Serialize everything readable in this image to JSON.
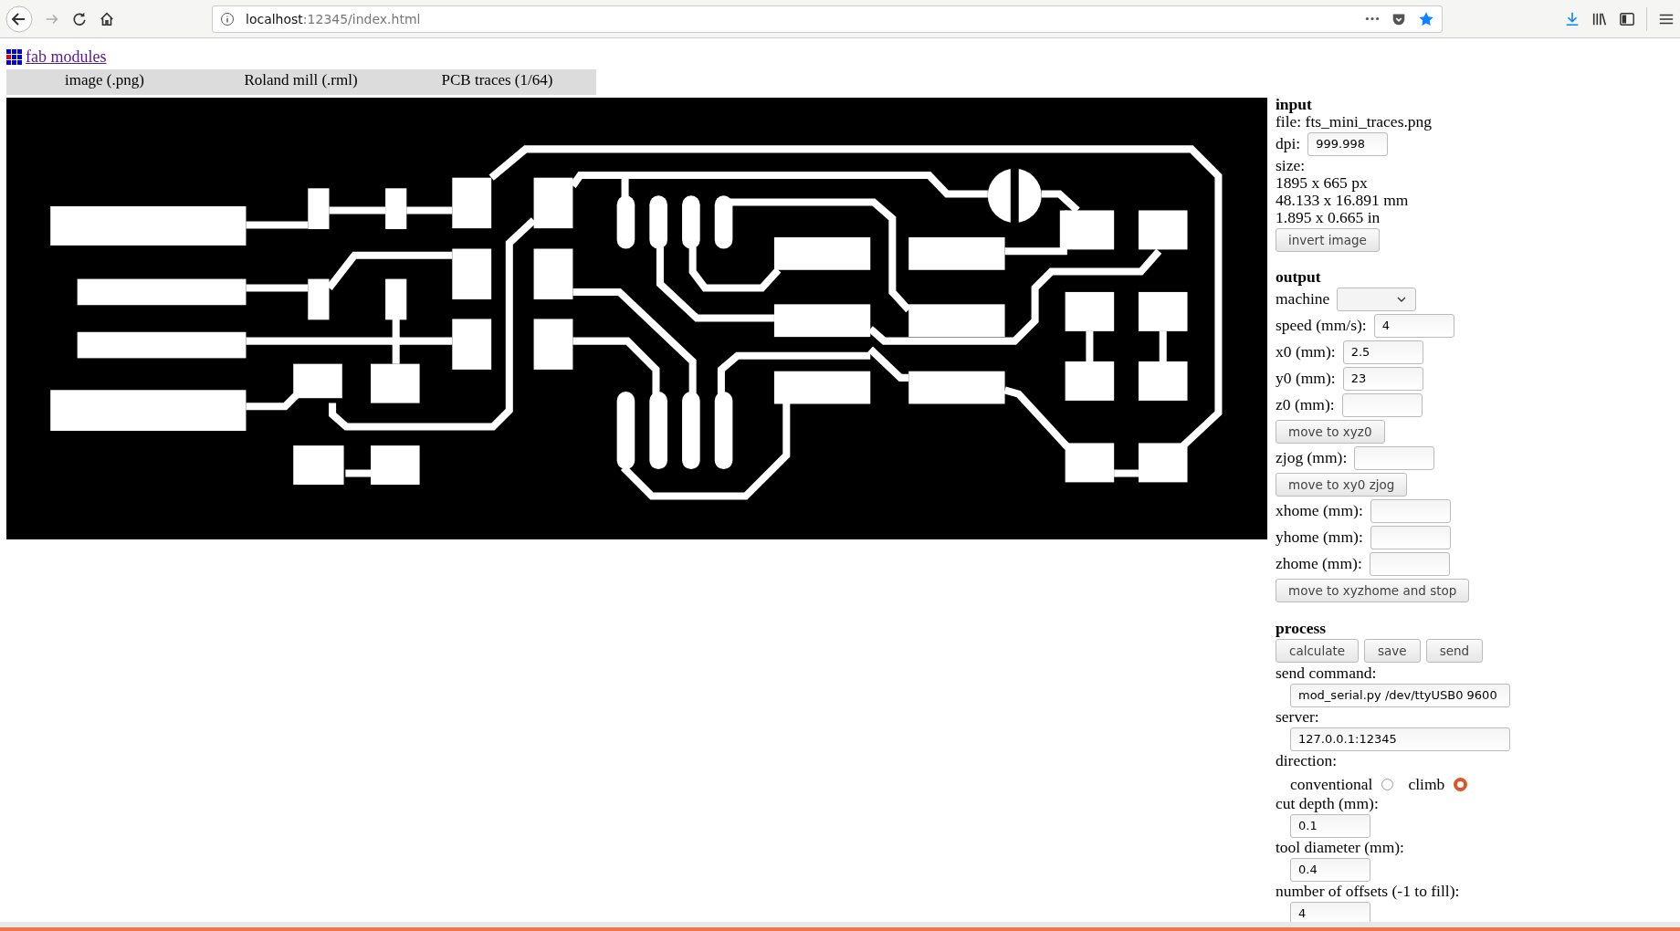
{
  "browser": {
    "url_host": "localhost",
    "url_path": ":12345/index.html"
  },
  "header": {
    "logo_link": "fab modules"
  },
  "modules": [
    "image (.png)",
    "Roland mill (.rml)",
    "PCB traces (1/64)"
  ],
  "input": {
    "heading": "input",
    "file": "file: fts_mini_traces.png",
    "dpi_label": "dpi:",
    "dpi_value": "999.998",
    "size_label": "size:",
    "size_lines": [
      "1895 x 665 px",
      "48.133 x 16.891 mm",
      "1.895 x 0.665 in"
    ],
    "button": "invert image"
  },
  "output": {
    "heading": "output",
    "controls": [
      {
        "kind": "select",
        "label": "machine"
      },
      {
        "kind": "field",
        "label": "speed (mm/s):",
        "value": "4"
      },
      {
        "kind": "field",
        "label": "x0 (mm):",
        "value": "2.5"
      },
      {
        "kind": "field",
        "label": "y0 (mm):",
        "value": "23"
      },
      {
        "kind": "field",
        "label": "z0 (mm):"
      },
      {
        "kind": "button",
        "label": "move to xyz0"
      },
      {
        "kind": "field",
        "label": "zjog (mm):"
      },
      {
        "kind": "button",
        "label": "move to xy0 zjog"
      },
      {
        "kind": "field",
        "label": "xhome (mm):"
      },
      {
        "kind": "field",
        "label": "yhome (mm):"
      },
      {
        "kind": "field",
        "label": "zhome (mm):"
      },
      {
        "kind": "button",
        "label": "move to xyzhome and stop"
      }
    ]
  },
  "process": {
    "heading": "process",
    "buttons": [
      "calculate",
      "save",
      "send"
    ],
    "items": [
      {
        "kind": "field",
        "label": "send command:",
        "value": "mod_serial.py /dev/ttyUSB0 9600",
        "wide": true
      },
      {
        "kind": "field",
        "label": "server:",
        "value": "127.0.0.1:12345",
        "wide": true
      },
      {
        "kind": "radios",
        "label": "direction:",
        "options": [
          {
            "label": "conventional",
            "selected": false
          },
          {
            "label": "climb",
            "selected": true
          }
        ]
      },
      {
        "kind": "field",
        "label": "cut depth (mm):",
        "value": "0.1",
        "wide": false
      },
      {
        "kind": "field",
        "label": "tool diameter (mm):",
        "value": "0.4",
        "wide": false
      },
      {
        "kind": "field",
        "label": "number of offsets (-1 to fill):",
        "value": "4",
        "wide": false
      }
    ]
  }
}
